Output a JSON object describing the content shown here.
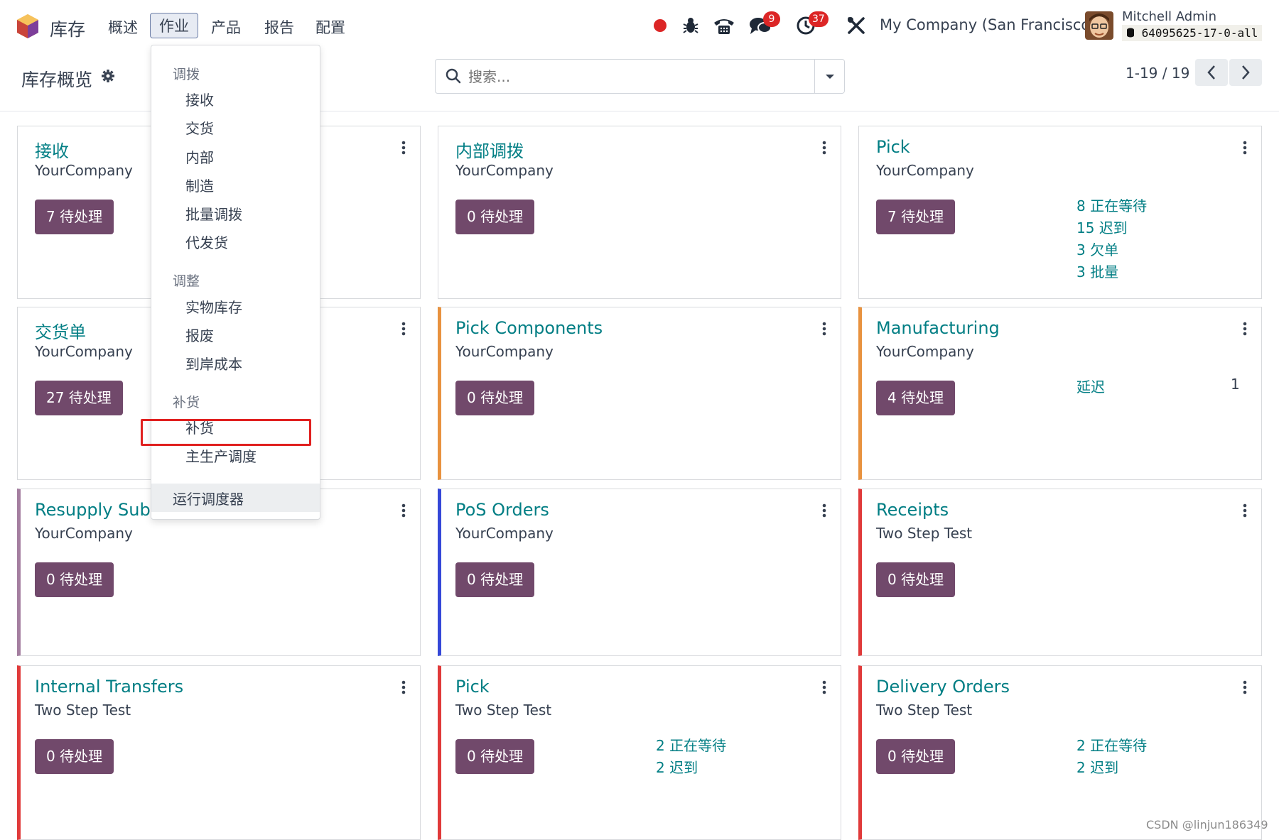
{
  "navbar": {
    "app_name": "库存",
    "menus": [
      "概述",
      "作业",
      "产品",
      "报告",
      "配置"
    ],
    "messages_count": "9",
    "activities_count": "37",
    "company": "My Company (San Francisco)",
    "user_name": "Mitchell Admin",
    "db_name": "64095625-17-0-all"
  },
  "control": {
    "breadcrumb": "库存概览",
    "search_placeholder": "搜索...",
    "pager": "1-19 / 19"
  },
  "dropdown": {
    "sections": [
      {
        "title": "调拨",
        "items": [
          "接收",
          "交货",
          "内部",
          "制造",
          "批量调拨",
          "代发货"
        ]
      },
      {
        "title": "调整",
        "items": [
          "实物库存",
          "报废",
          "到岸成本"
        ]
      },
      {
        "title": "补货",
        "items": [
          "补货",
          "主生产调度"
        ]
      }
    ],
    "footer": "运行调度器",
    "highlighted_item": "补货"
  },
  "cards": [
    {
      "title": "接收",
      "subtitle": "YourCompany",
      "button": "7 待处理",
      "accent": "",
      "stats": []
    },
    {
      "title": "内部调拨",
      "subtitle": "YourCompany",
      "button": "0 待处理",
      "accent": "",
      "stats": []
    },
    {
      "title": "Pick",
      "subtitle": "YourCompany",
      "button": "7 待处理",
      "accent": "",
      "stats": [
        "8 正在等待",
        "15 迟到",
        "3 欠单",
        "3 批量"
      ]
    },
    {
      "title": "交货单",
      "subtitle": "YourCompany",
      "button": "27 待处理",
      "accent": "",
      "stats": []
    },
    {
      "title": "Pick Components",
      "subtitle": "YourCompany",
      "button": "0 待处理",
      "accent": "#e8923f",
      "stats": []
    },
    {
      "title": "Manufacturing",
      "subtitle": "YourCompany",
      "button": "4 待处理",
      "accent": "#e8923f",
      "stats": [
        "延迟"
      ],
      "stat_value": "1"
    },
    {
      "title": "Resupply Subcontractor",
      "subtitle": "YourCompany",
      "button": "0 待处理",
      "accent": "#a47ea0",
      "stats": []
    },
    {
      "title": "PoS Orders",
      "subtitle": "YourCompany",
      "button": "0 待处理",
      "accent": "#3548d8",
      "stats": []
    },
    {
      "title": "Receipts",
      "subtitle": "Two Step Test",
      "button": "0 待处理",
      "accent": "#e03a3a",
      "stats": []
    },
    {
      "title": "Internal Transfers",
      "subtitle": "Two Step Test",
      "button": "0 待处理",
      "accent": "#e03a3a",
      "stats": []
    },
    {
      "title": "Pick",
      "subtitle": "Two Step Test",
      "button": "0 待处理",
      "accent": "#e03a3a",
      "stats": [
        "2 正在等待",
        "2 迟到"
      ]
    },
    {
      "title": "Delivery Orders",
      "subtitle": "Two Step Test",
      "button": "0 待处理",
      "accent": "#e03a3a",
      "stats": [
        "2 正在等待",
        "2 迟到"
      ]
    }
  ],
  "watermark": "CSDN @linjun186349"
}
